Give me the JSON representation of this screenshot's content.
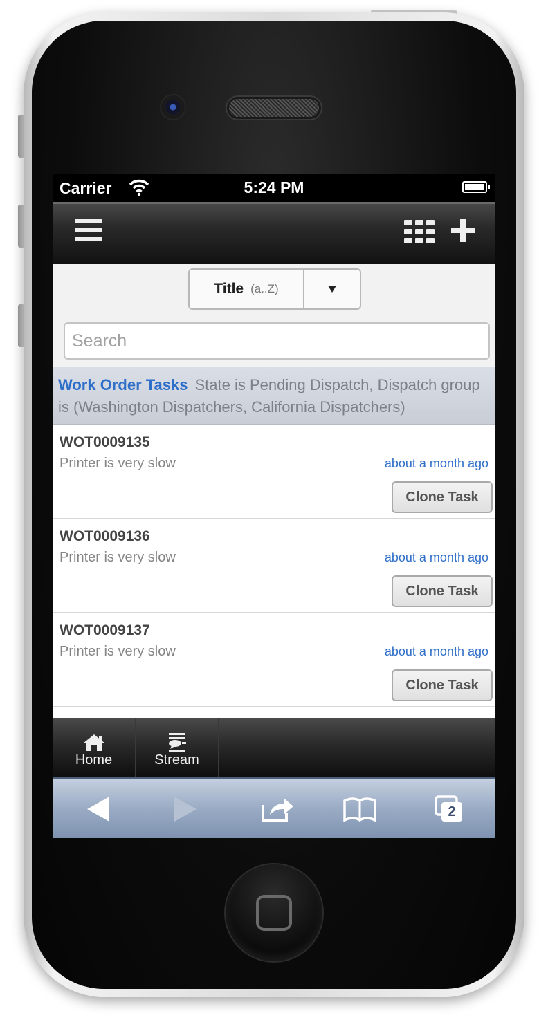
{
  "status_bar": {
    "carrier": "Carrier",
    "time": "5:24 PM"
  },
  "header": {
    "icons": [
      "menu-icon",
      "grid-icon",
      "plus-icon"
    ]
  },
  "sort": {
    "field": "Title",
    "order": "(a..Z)"
  },
  "search": {
    "placeholder": "Search",
    "value": ""
  },
  "filter": {
    "title": "Work Order Tasks",
    "description": "State is Pending Dispatch,  Dispatch group is (Washington Dispatchers, California Dispatchers)"
  },
  "tasks": [
    {
      "id": "WOT0009135",
      "description": "Printer is very slow",
      "time": "about a month ago",
      "button": "Clone Task"
    },
    {
      "id": "WOT0009136",
      "description": "Printer is very slow",
      "time": "about a month ago",
      "button": "Clone Task"
    },
    {
      "id": "WOT0009137",
      "description": "Printer is very slow",
      "time": "about a month ago",
      "button": "Clone Task"
    }
  ],
  "tabs": [
    {
      "label": "Home",
      "icon": "home-icon"
    },
    {
      "label": "Stream",
      "icon": "stream-icon"
    }
  ],
  "safari": {
    "tab_count": "2",
    "icons": [
      "back-arrow-icon",
      "forward-arrow-icon",
      "share-icon",
      "bookmarks-icon",
      "tabs-icon"
    ]
  },
  "colors": {
    "link_blue": "#2f6fc9",
    "header_dark": "#111111",
    "safari_blue": "#9aabc4"
  }
}
